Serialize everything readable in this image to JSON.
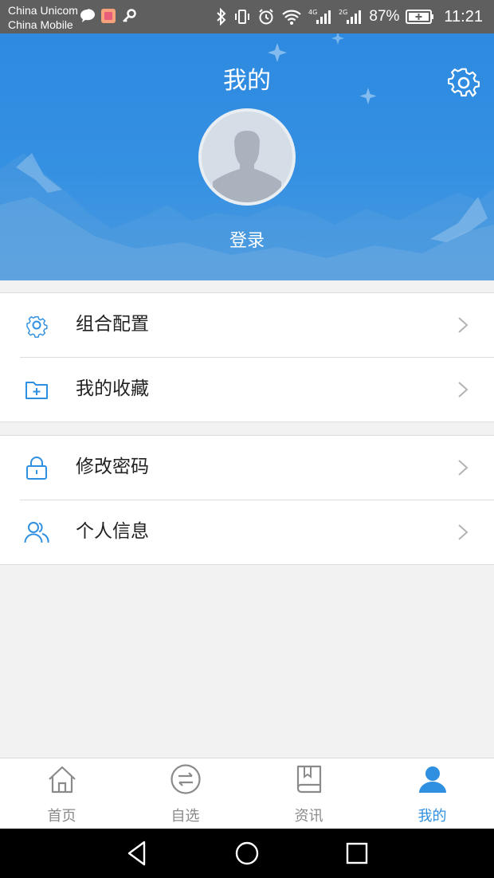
{
  "status_bar": {
    "carrier_1": "China Unicom",
    "carrier_2": "China Mobile",
    "battery_percent": "87%",
    "time": "11:21",
    "network_1": "4G",
    "network_2": "2G"
  },
  "header": {
    "title": "我的",
    "login_label": "登录"
  },
  "menu": {
    "group1": [
      {
        "label": "组合配置",
        "icon": "gear-icon"
      },
      {
        "label": "我的收藏",
        "icon": "folder-plus-icon"
      }
    ],
    "group2": [
      {
        "label": "修改密码",
        "icon": "lock-icon"
      },
      {
        "label": "个人信息",
        "icon": "users-icon"
      }
    ]
  },
  "tabbar": {
    "tabs": [
      {
        "label": "首页",
        "icon": "home-icon",
        "active": false
      },
      {
        "label": "自选",
        "icon": "swap-icon",
        "active": false
      },
      {
        "label": "资讯",
        "icon": "book-icon",
        "active": false
      },
      {
        "label": "我的",
        "icon": "person-icon",
        "active": true
      }
    ]
  },
  "colors": {
    "accent": "#2f8fe0",
    "header_bg": "#3590e2",
    "inactive_tab": "#8a8a8a"
  }
}
